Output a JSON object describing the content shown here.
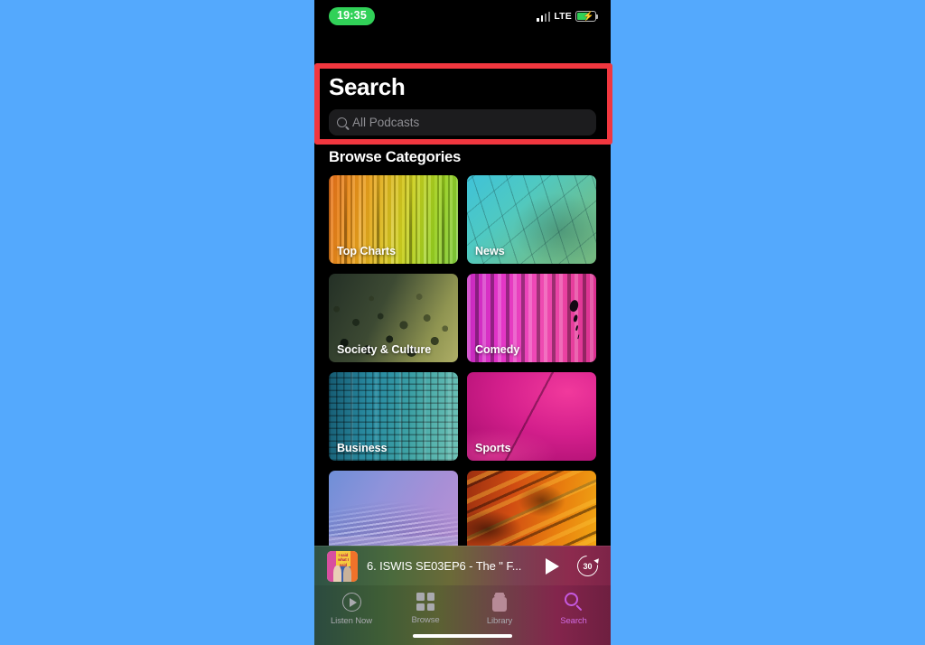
{
  "background_color": "#54a9fd",
  "highlight": {
    "color": "#f1373f",
    "target": "search-header-region"
  },
  "status_bar": {
    "time": "19:35",
    "time_pill_color": "#31d158",
    "carrier": "LTE",
    "signal_icon": "cellular-signal-icon",
    "battery_icon": "battery-charging-icon",
    "battery_color": "#31d158",
    "charging_glyph": "⚡"
  },
  "header": {
    "title": "Search",
    "search": {
      "icon": "search-icon",
      "placeholder": "All Podcasts",
      "value": ""
    }
  },
  "main": {
    "section_title": "Browse Categories",
    "categories": [
      {
        "label": "Top Charts",
        "art": "art-topcharts"
      },
      {
        "label": "News",
        "art": "art-news"
      },
      {
        "label": "Society & Culture",
        "art": "art-society"
      },
      {
        "label": "Comedy",
        "art": "art-comedy"
      },
      {
        "label": "Business",
        "art": "art-business"
      },
      {
        "label": "Sports",
        "art": "art-sports"
      },
      {
        "label": "",
        "art": "art-books"
      },
      {
        "label": "",
        "art": "art-tech"
      }
    ]
  },
  "mini_player": {
    "artwork": "podcast-artwork",
    "artwork_text": "I said what I said",
    "title": "6. ISWIS SE03EP6 - The \" F...",
    "play_button": "play-icon",
    "skip_button_label": "30",
    "skip_button": "skip-forward-30-icon"
  },
  "tab_bar": {
    "tabs": [
      {
        "label": "Listen Now",
        "icon": "listen-now-icon",
        "active": false
      },
      {
        "label": "Browse",
        "icon": "browse-grid-icon",
        "active": false
      },
      {
        "label": "Library",
        "icon": "library-icon",
        "active": false
      },
      {
        "label": "Search",
        "icon": "search-icon",
        "active": true
      }
    ],
    "active_color": "#d06ae0",
    "inactive_color": "#a9a9ae"
  }
}
